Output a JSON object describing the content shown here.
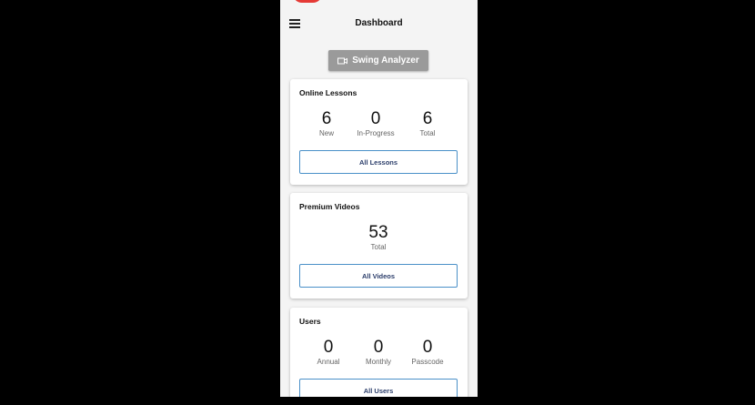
{
  "header": {
    "title": "Dashboard",
    "menu_icon": "hamburger-icon"
  },
  "swing_analyzer": {
    "label": "Swing Analyzer",
    "icon": "video-camera-icon"
  },
  "online_lessons": {
    "title": "Online Lessons",
    "stats": [
      {
        "value": "6",
        "label": "New"
      },
      {
        "value": "0",
        "label": "In-Progress"
      },
      {
        "value": "6",
        "label": "Total"
      }
    ],
    "button": "All Lessons"
  },
  "premium_videos": {
    "title": "Premium Videos",
    "stats": [
      {
        "value": "53",
        "label": "Total"
      }
    ],
    "button": "All Videos"
  },
  "users": {
    "title": "Users",
    "stats": [
      {
        "value": "0",
        "label": "Annual"
      },
      {
        "value": "0",
        "label": "Monthly"
      },
      {
        "value": "0",
        "label": "Passcode"
      }
    ],
    "button": "All Users"
  },
  "colors": {
    "accent_border": "#4a90c8",
    "button_text": "#2c3e6b",
    "swing_button_bg": "#9a9a9a",
    "logo_red": "#e53935"
  }
}
